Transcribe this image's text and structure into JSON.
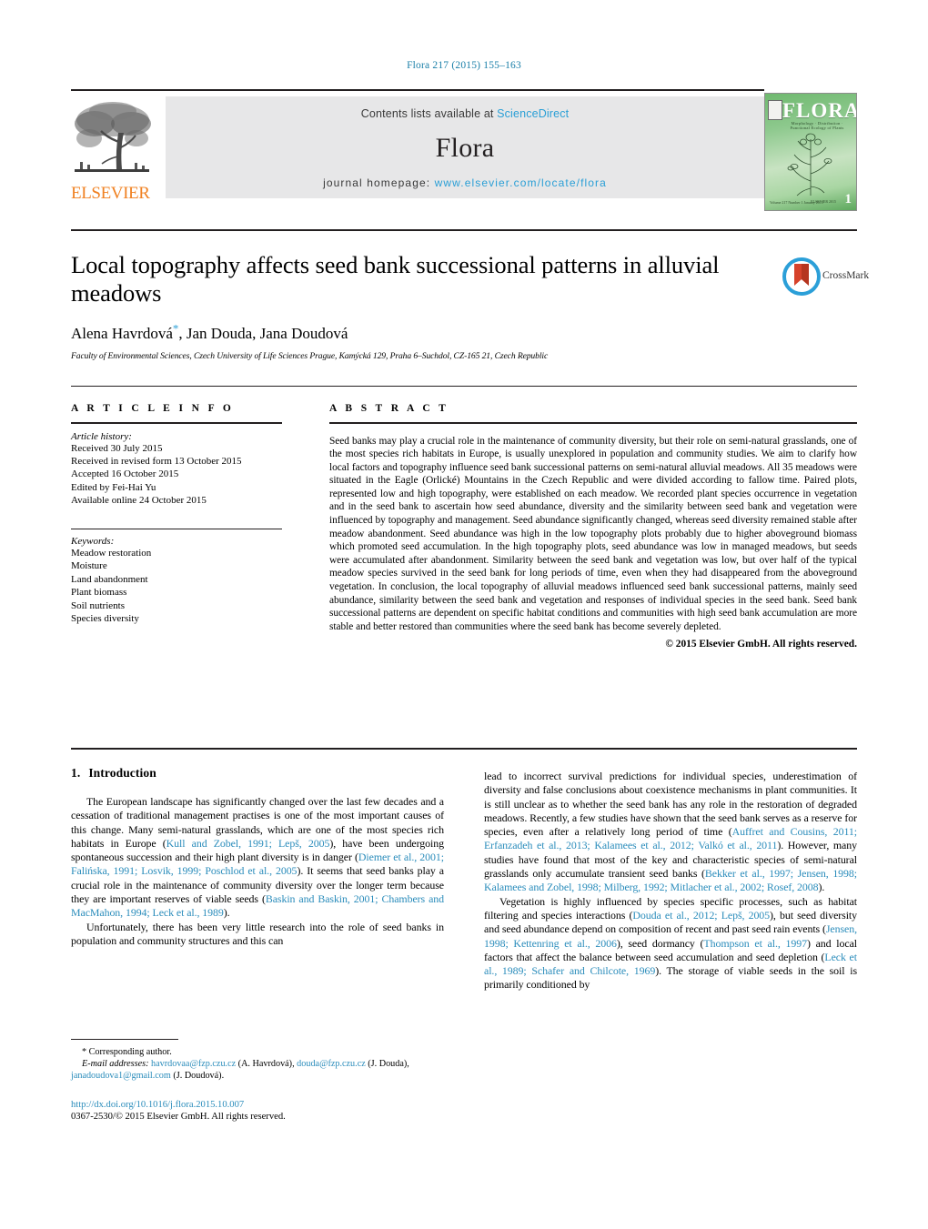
{
  "running_head": "Flora 217 (2015) 155–163",
  "masthead": {
    "contents_text": "Contents lists available at ",
    "sciencedirect": "ScienceDirect",
    "journal_title": "Flora",
    "homepage_label": "journal homepage: ",
    "homepage_url": "www.elsevier.com/locate/flora",
    "publisher": "ELSEVIER",
    "publisher_logo_icon": "elsevier-tree-icon",
    "cover": {
      "title": "FLORA",
      "subtitle": "Morphology · Distribution · Functional Ecology of Plants",
      "issue_number": "1",
      "footer_left": "Volume 217\nNumber 1\nJanuary 2015",
      "footer_right": "ELSEVIER 2015"
    }
  },
  "crossmark": {
    "label": "CrossMark",
    "icon": "crossmark-icon"
  },
  "article": {
    "title": "Local topography affects seed bank successional patterns in alluvial meadows",
    "authors": "Alena Havrdová, Jan Douda, Jana Doudová",
    "corresponding_marker": "*",
    "affiliation": "Faculty of Environmental Sciences, Czech University of Life Sciences Prague, Kamýcká 129, Praha 6–Suchdol, CZ-165 21, Czech Republic"
  },
  "article_info": {
    "heading": "A R T I C L E    I N F O",
    "history_label": "Article history:",
    "history": [
      "Received 30 July 2015",
      "Received in revised form 13 October 2015",
      "Accepted 16 October 2015",
      "Edited by Fei-Hai Yu",
      "Available online 24 October 2015"
    ],
    "keywords_label": "Keywords:",
    "keywords": [
      "Meadow restoration",
      "Moisture",
      "Land abandonment",
      "Plant biomass",
      "Soil nutrients",
      "Species diversity"
    ]
  },
  "abstract": {
    "heading": "A B S T R A C T",
    "text": "Seed banks may play a crucial role in the maintenance of community diversity, but their role on semi-natural grasslands, one of the most species rich habitats in Europe, is usually unexplored in population and community studies. We aim to clarify how local factors and topography influence seed bank successional patterns on semi-natural alluvial meadows. All 35 meadows were situated in the Eagle (Orlické) Mountains in the Czech Republic and were divided according to fallow time. Paired plots, represented low and high topography, were established on each meadow. We recorded plant species occurrence in vegetation and in the seed bank to ascertain how seed abundance, diversity and the similarity between seed bank and vegetation were influenced by topography and management. Seed abundance significantly changed, whereas seed diversity remained stable after meadow abandonment. Seed abundance was high in the low topography plots probably due to higher aboveground biomass which promoted seed accumulation. In the high topography plots, seed abundance was low in managed meadows, but seeds were accumulated after abandonment. Similarity between the seed bank and vegetation was low, but over half of the typical meadow species survived in the seed bank for long periods of time, even when they had disappeared from the aboveground vegetation. In conclusion, the local topography of alluvial meadows influenced seed bank successional patterns, mainly seed abundance, similarity between the seed bank and vegetation and responses of individual species in the seed bank. Seed bank successional patterns are dependent on specific habitat conditions and communities with high seed bank accumulation are more stable and better restored than communities where the seed bank has become severely depleted.",
    "copyright": "© 2015 Elsevier GmbH. All rights reserved."
  },
  "introduction": {
    "number": "1.",
    "heading": "Introduction",
    "left_paragraphs": [
      {
        "segments": [
          {
            "t": "The European landscape has significantly changed over the last few decades and a cessation of traditional management practises is one of the most important causes of this change. Many semi-natural grasslands, which are one of the most species rich habitats in Europe (",
            "link": false
          },
          {
            "t": "Kull and Zobel, 1991; Lepš, 2005",
            "link": true
          },
          {
            "t": "), have been undergoing spontaneous succession and their high plant diversity is in danger (",
            "link": false
          },
          {
            "t": "Diemer et al., 2001; Falińska, 1991; Losvik, 1999; Poschlod et al., 2005",
            "link": true
          },
          {
            "t": "). It seems that seed banks play a crucial role in the maintenance of community diversity over the longer term because they are important reserves of viable seeds (",
            "link": false
          },
          {
            "t": "Baskin and Baskin, 2001; Chambers and MacMahon, 1994; Leck et al., 1989",
            "link": true
          },
          {
            "t": ").",
            "link": false
          }
        ]
      },
      {
        "segments": [
          {
            "t": "Unfortunately, there has been very little research into the role of seed banks in population and community structures and this can",
            "link": false
          }
        ]
      }
    ],
    "right_paragraphs": [
      {
        "indent": false,
        "segments": [
          {
            "t": "lead to incorrect survival predictions for individual species, underestimation of diversity and false conclusions about coexistence mechanisms in plant communities. It is still unclear as to whether the seed bank has any role in the restoration of degraded meadows. Recently, a few studies have shown that the seed bank serves as a reserve for species, even after a relatively long period of time (",
            "link": false
          },
          {
            "t": "Auffret and Cousins, 2011; Erfanzadeh et al., 2013; Kalamees et al., 2012; Valkó et al., 2011",
            "link": true
          },
          {
            "t": "). However, many studies have found that most of the key and characteristic species of semi-natural grasslands only accumulate transient seed banks (",
            "link": false
          },
          {
            "t": "Bekker et al., 1997; Jensen, 1998; Kalamees and Zobel, 1998; Milberg, 1992; Mitlacher et al., 2002; Rosef, 2008",
            "link": true
          },
          {
            "t": ").",
            "link": false
          }
        ]
      },
      {
        "indent": true,
        "segments": [
          {
            "t": "Vegetation is highly influenced by species specific processes, such as habitat filtering and species interactions (",
            "link": false
          },
          {
            "t": "Douda et al., 2012; Lepš, 2005",
            "link": true
          },
          {
            "t": "), but seed diversity and seed abundance depend on composition of recent and past seed rain events (",
            "link": false
          },
          {
            "t": "Jensen, 1998; Kettenring et al., 2006",
            "link": true
          },
          {
            "t": "), seed dormancy (",
            "link": false
          },
          {
            "t": "Thompson et al., 1997",
            "link": true
          },
          {
            "t": ") and local factors that affect the balance between seed accumulation and seed depletion (",
            "link": false
          },
          {
            "t": "Leck et al., 1989; Schafer and Chilcote, 1969",
            "link": true
          },
          {
            "t": "). The storage of viable seeds in the soil is primarily conditioned by",
            "link": false
          }
        ]
      }
    ]
  },
  "footnote": {
    "corresponding": "* Corresponding author.",
    "email_label": "E-mail addresses:",
    "emails": [
      {
        "address": "havrdovaa@fzp.czu.cz",
        "owner": "(A. Havrdová),"
      },
      {
        "address": "douda@fzp.czu.cz",
        "owner": "(J. Douda),"
      },
      {
        "address": "janadoudova1@gmail.com",
        "owner": "(J. Doudová)."
      }
    ]
  },
  "doi": {
    "url": "http://dx.doi.org/10.1016/j.flora.2015.10.007",
    "issn_line": "0367-2530/© 2015 Elsevier GmbH. All rights reserved."
  },
  "colors": {
    "link": "#2a8cbb",
    "sciencedirect": "#2a9fd6",
    "elsevier_orange": "#f08122",
    "band_bg": "#e7e7e8"
  }
}
